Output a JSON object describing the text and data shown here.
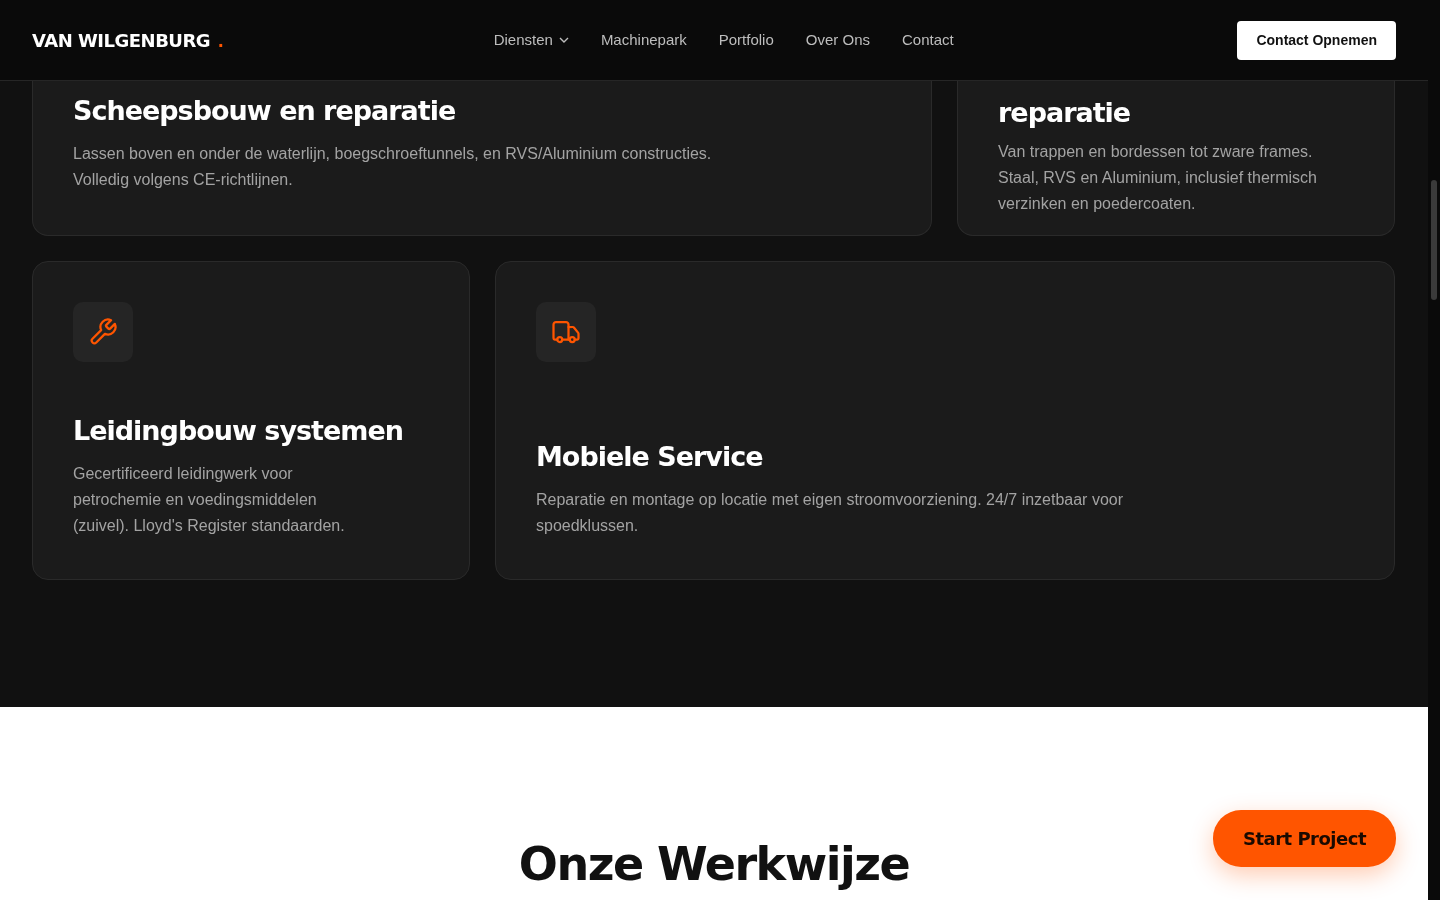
{
  "navbar": {
    "logo": "VAN WILGENBURG",
    "logo_dot": ".",
    "links": [
      {
        "label": "Diensten",
        "dropdown": true
      },
      {
        "label": "Machinepark",
        "dropdown": false
      },
      {
        "label": "Portfolio",
        "dropdown": false
      },
      {
        "label": "Over Ons",
        "dropdown": false
      },
      {
        "label": "Contact",
        "dropdown": false
      }
    ],
    "cta": "Contact Opnemen"
  },
  "services": {
    "rows": [
      [
        {
          "title": "Scheepsbouw en reparatie",
          "text": "Lassen boven en onder de waterlijn, boegschroeftunnels, en RVS/Aluminium constructies. Volledig volgens CE-richtlijnen.",
          "wide": true
        },
        {
          "title": "reparatie",
          "text": "Van trappen en bordessen tot zware frames. Staal, RVS en Aluminium, inclusief thermisch verzinken en poedercoaten.",
          "wide": false
        }
      ],
      [
        {
          "title": "Leidingbouw systemen",
          "text": "Gecertificeerd leidingwerk voor petrochemie en voedingsmiddelen (zuivel). Lloyd's Register standaarden.",
          "wide": false,
          "icon": true
        },
        {
          "title": "Mobiele Service",
          "text": "Reparatie en montage op locatie met eigen stroomvoorziening. 24/7 inzetbaar voor spoedklussen.",
          "wide": true,
          "icon": true
        }
      ]
    ]
  },
  "process": {
    "title": "Onze Werkwijze"
  },
  "floating_button": "Start Project"
}
